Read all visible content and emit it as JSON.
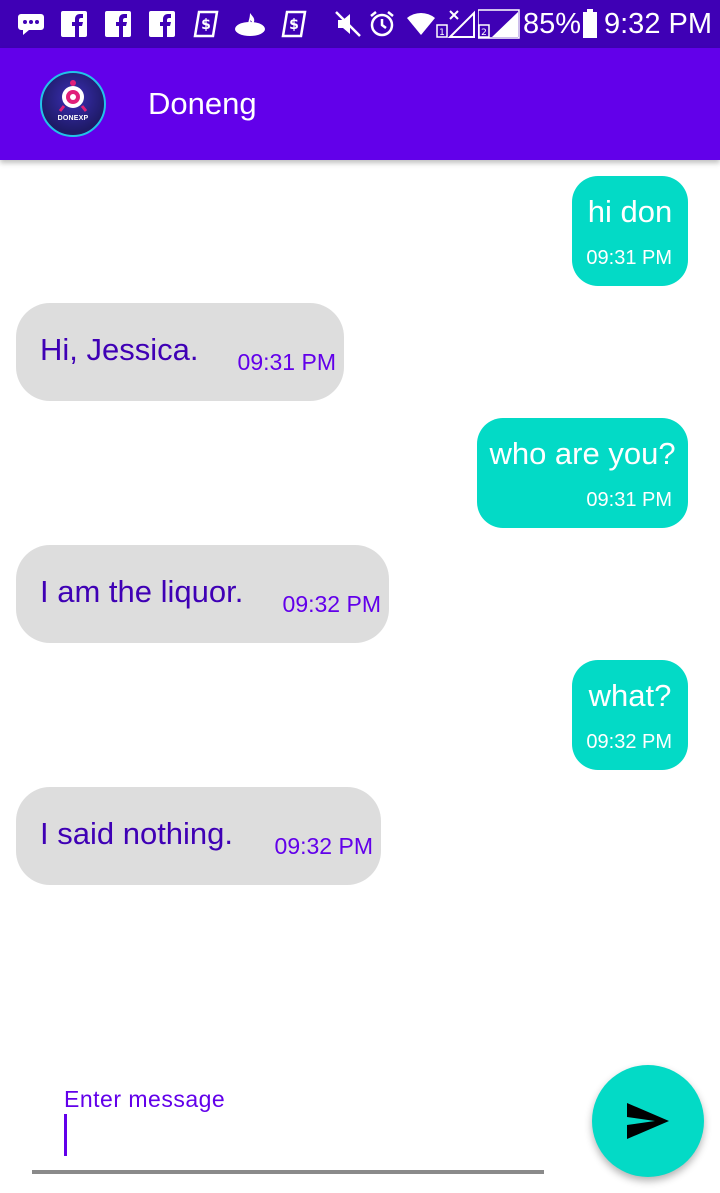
{
  "status_bar": {
    "battery": "85%",
    "time": "9:32 PM",
    "icons": [
      "messages-icon",
      "facebook-icon",
      "facebook-icon",
      "facebook-icon",
      "cash-app-icon",
      "santander-icon",
      "cash-app-icon",
      "mute-icon",
      "alarm-icon",
      "wifi-icon",
      "sim1-signal-icon",
      "sim2-signal-icon",
      "battery-icon"
    ]
  },
  "app_bar": {
    "avatar_label": "DONEXP",
    "title": "Doneng"
  },
  "messages": [
    {
      "side": "sent",
      "text": "hi don",
      "time": "09:31 PM"
    },
    {
      "side": "received",
      "text": "Hi, Jessica.",
      "time": "09:31 PM"
    },
    {
      "side": "sent",
      "text": "who are you?",
      "time": "09:31 PM"
    },
    {
      "side": "received",
      "text": "I am the liquor.",
      "time": "09:32 PM"
    },
    {
      "side": "sent",
      "text": "what?",
      "time": "09:32 PM"
    },
    {
      "side": "received",
      "text": "I said nothing.",
      "time": "09:32 PM"
    }
  ],
  "composer": {
    "label": "Enter message",
    "value": "",
    "send_icon": "send-icon"
  },
  "colors": {
    "status_bar": "#3f00b5",
    "app_bar": "#6200ea",
    "sent_bubble": "#03dac6",
    "received_bubble": "#dddddd",
    "received_text": "#3f00b5",
    "accent": "#6200ea"
  }
}
